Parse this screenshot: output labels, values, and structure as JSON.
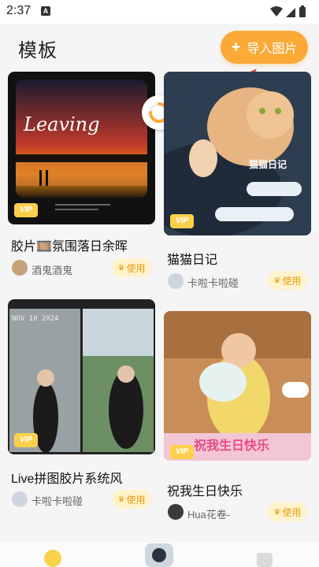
{
  "status_bar": {
    "time": "2:37",
    "app_badge": "A"
  },
  "header": {
    "title": "模板",
    "import_label": "导入图片"
  },
  "cards": [
    {
      "title": "胶片🎞️氛围落日余晖",
      "author": "酒鬼酒鬼",
      "vip": "VIP",
      "use": "使用",
      "image_text": "Leaving"
    },
    {
      "title": "猫猫日记",
      "author": "卡啦卡啦碰",
      "vip": "VIP",
      "use": "使用",
      "image_text": "猫猫日记"
    },
    {
      "title": "Live拼图胶片系统风",
      "author": "卡啦卡啦碰",
      "vip": "VIP",
      "use": "使用",
      "image_text": "NOV 10 2024"
    },
    {
      "title": "祝我生日快乐",
      "author": "Hua花卷-",
      "vip": "VIP",
      "use": "使用",
      "image_text": "祝我生日快乐"
    }
  ],
  "colors": {
    "accent": "#fba937",
    "vip": "#fbd14b",
    "use_bg": "#fff3cc",
    "use_text": "#e89b12"
  }
}
